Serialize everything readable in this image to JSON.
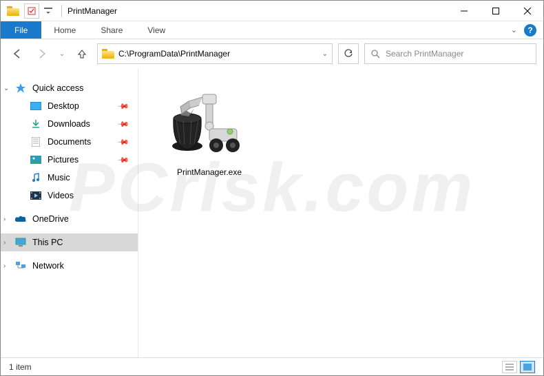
{
  "titlebar": {
    "title": "PrintManager"
  },
  "ribbon": {
    "file": "File",
    "tabs": [
      "Home",
      "Share",
      "View"
    ]
  },
  "address": {
    "path": "C:\\ProgramData\\PrintManager"
  },
  "search": {
    "placeholder": "Search PrintManager"
  },
  "sidebar": {
    "quick_access": {
      "label": "Quick access",
      "items": [
        {
          "label": "Desktop",
          "icon": "desktop",
          "pinned": true
        },
        {
          "label": "Downloads",
          "icon": "downloads",
          "pinned": true
        },
        {
          "label": "Documents",
          "icon": "documents",
          "pinned": true
        },
        {
          "label": "Pictures",
          "icon": "pictures",
          "pinned": true
        },
        {
          "label": "Music",
          "icon": "music",
          "pinned": false
        },
        {
          "label": "Videos",
          "icon": "videos",
          "pinned": false
        }
      ]
    },
    "onedrive": {
      "label": "OneDrive"
    },
    "thispc": {
      "label": "This PC"
    },
    "network": {
      "label": "Network"
    }
  },
  "content": {
    "files": [
      {
        "name": "PrintManager.exe"
      }
    ]
  },
  "status": {
    "count": "1 item"
  },
  "watermark": "PCrisk.com"
}
